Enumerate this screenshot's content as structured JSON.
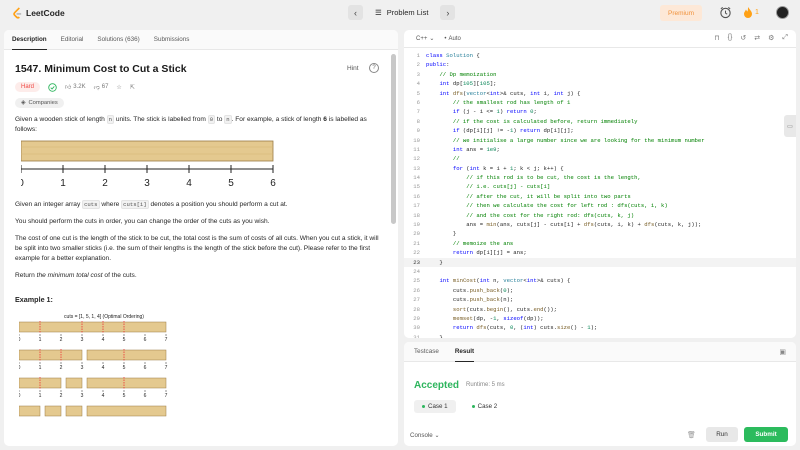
{
  "topbar": {
    "logo_text": "LeetCode",
    "problem_list_label": "Problem List",
    "premium_label": "Premium",
    "streak_count": "1"
  },
  "left_tabs": [
    {
      "label": "Description"
    },
    {
      "label": "Editorial"
    },
    {
      "label": "Solutions (636)"
    },
    {
      "label": "Submissions"
    }
  ],
  "problem": {
    "title": "1547. Minimum Cost to Cut a Stick",
    "hint_label": "Hint",
    "difficulty": "Hard",
    "likes": "3.2K",
    "dislikes": "67",
    "companies_label": "Companies",
    "desc1_a": "Given a wooden stick of length ",
    "desc1_n": "n",
    "desc1_b": " units. The stick is labelled from ",
    "desc1_zero": "0",
    "desc1_c": " to ",
    "desc1_n2": "n",
    "desc1_d": ". For example, a stick of length ",
    "desc1_six": "6",
    "desc1_e": " is labelled as follows:",
    "stick_labels": [
      "0",
      "1",
      "2",
      "3",
      "4",
      "5",
      "6"
    ],
    "desc2_a": "Given an integer array ",
    "desc2_cuts": "cuts",
    "desc2_b": " where ",
    "desc2_cutsi": "cuts[i]",
    "desc2_c": " denotes a position you should perform a cut at.",
    "desc3": "You should perform the cuts in order, you can change the order of the cuts as you wish.",
    "desc4": "The cost of one cut is the length of the stick to be cut, the total cost is the sum of costs of all cuts. When you cut a stick, it will be split into two smaller sticks (i.e. the sum of their lengths is the length of the stick before the cut). Please refer to the first example for a better explanation.",
    "desc5_a": "Return ",
    "desc5_em": "the minimum total cost",
    "desc5_b": " of the cuts.",
    "example_title": "Example 1:",
    "example_caption": "cuts = [1, 5, 1, 4] (Optimal Ordering)",
    "example_labels": [
      "0",
      "1",
      "2",
      "3",
      "4",
      "5",
      "6",
      "7"
    ]
  },
  "editor": {
    "language": "C++",
    "auto_label": "Auto",
    "lines": [
      "class Solution {",
      "public:",
      "    // Dp memoization",
      "    int dp[105][105];",
      "    int dfs(vector<int>& cuts, int i, int j) {",
      "        // the smallest rod has length of 1",
      "        if (j - i <= 1) return 0;",
      "        // if the cost is calculated before, return immediately",
      "        if (dp[i][j] != -1) return dp[i][j];",
      "        // we initialise a large number since we are looking for the minimum number",
      "        int ans = 1e9;",
      "        //",
      "        for (int k = i + 1; k < j; k++) {",
      "            // if this rod is to be cut, the cost is the length,",
      "            // i.e. cuts[j] - cuts[i]",
      "            // after the cut, it will be split into two parts",
      "            // then we calculate the cost for left rod : dfs(cuts, i, k)",
      "            // and the cost for the right rod: dfs(cuts, k, j)",
      "            ans = min(ans, cuts[j] - cuts[i] + dfs(cuts, i, k) + dfs(cuts, k, j));",
      "        }",
      "        // memoize the ans",
      "        return dp[i][j] = ans;",
      "    }",
      "",
      "    int minCost(int n, vector<int>& cuts) {",
      "        cuts.push_back(0);",
      "        cuts.push_back(n);",
      "        sort(cuts.begin(), cuts.end());",
      "        memset(dp, -1, sizeof(dp));",
      "        return dfs(cuts, 0, (int) cuts.size() - 1);",
      "    }"
    ]
  },
  "result": {
    "tabs": [
      {
        "label": "Testcase"
      },
      {
        "label": "Result"
      }
    ],
    "status": "Accepted",
    "runtime": "Runtime: 5 ms",
    "cases": [
      {
        "label": "Case 1"
      },
      {
        "label": "Case 2"
      }
    ],
    "console_label": "Console",
    "run_label": "Run",
    "submit_label": "Submit"
  }
}
